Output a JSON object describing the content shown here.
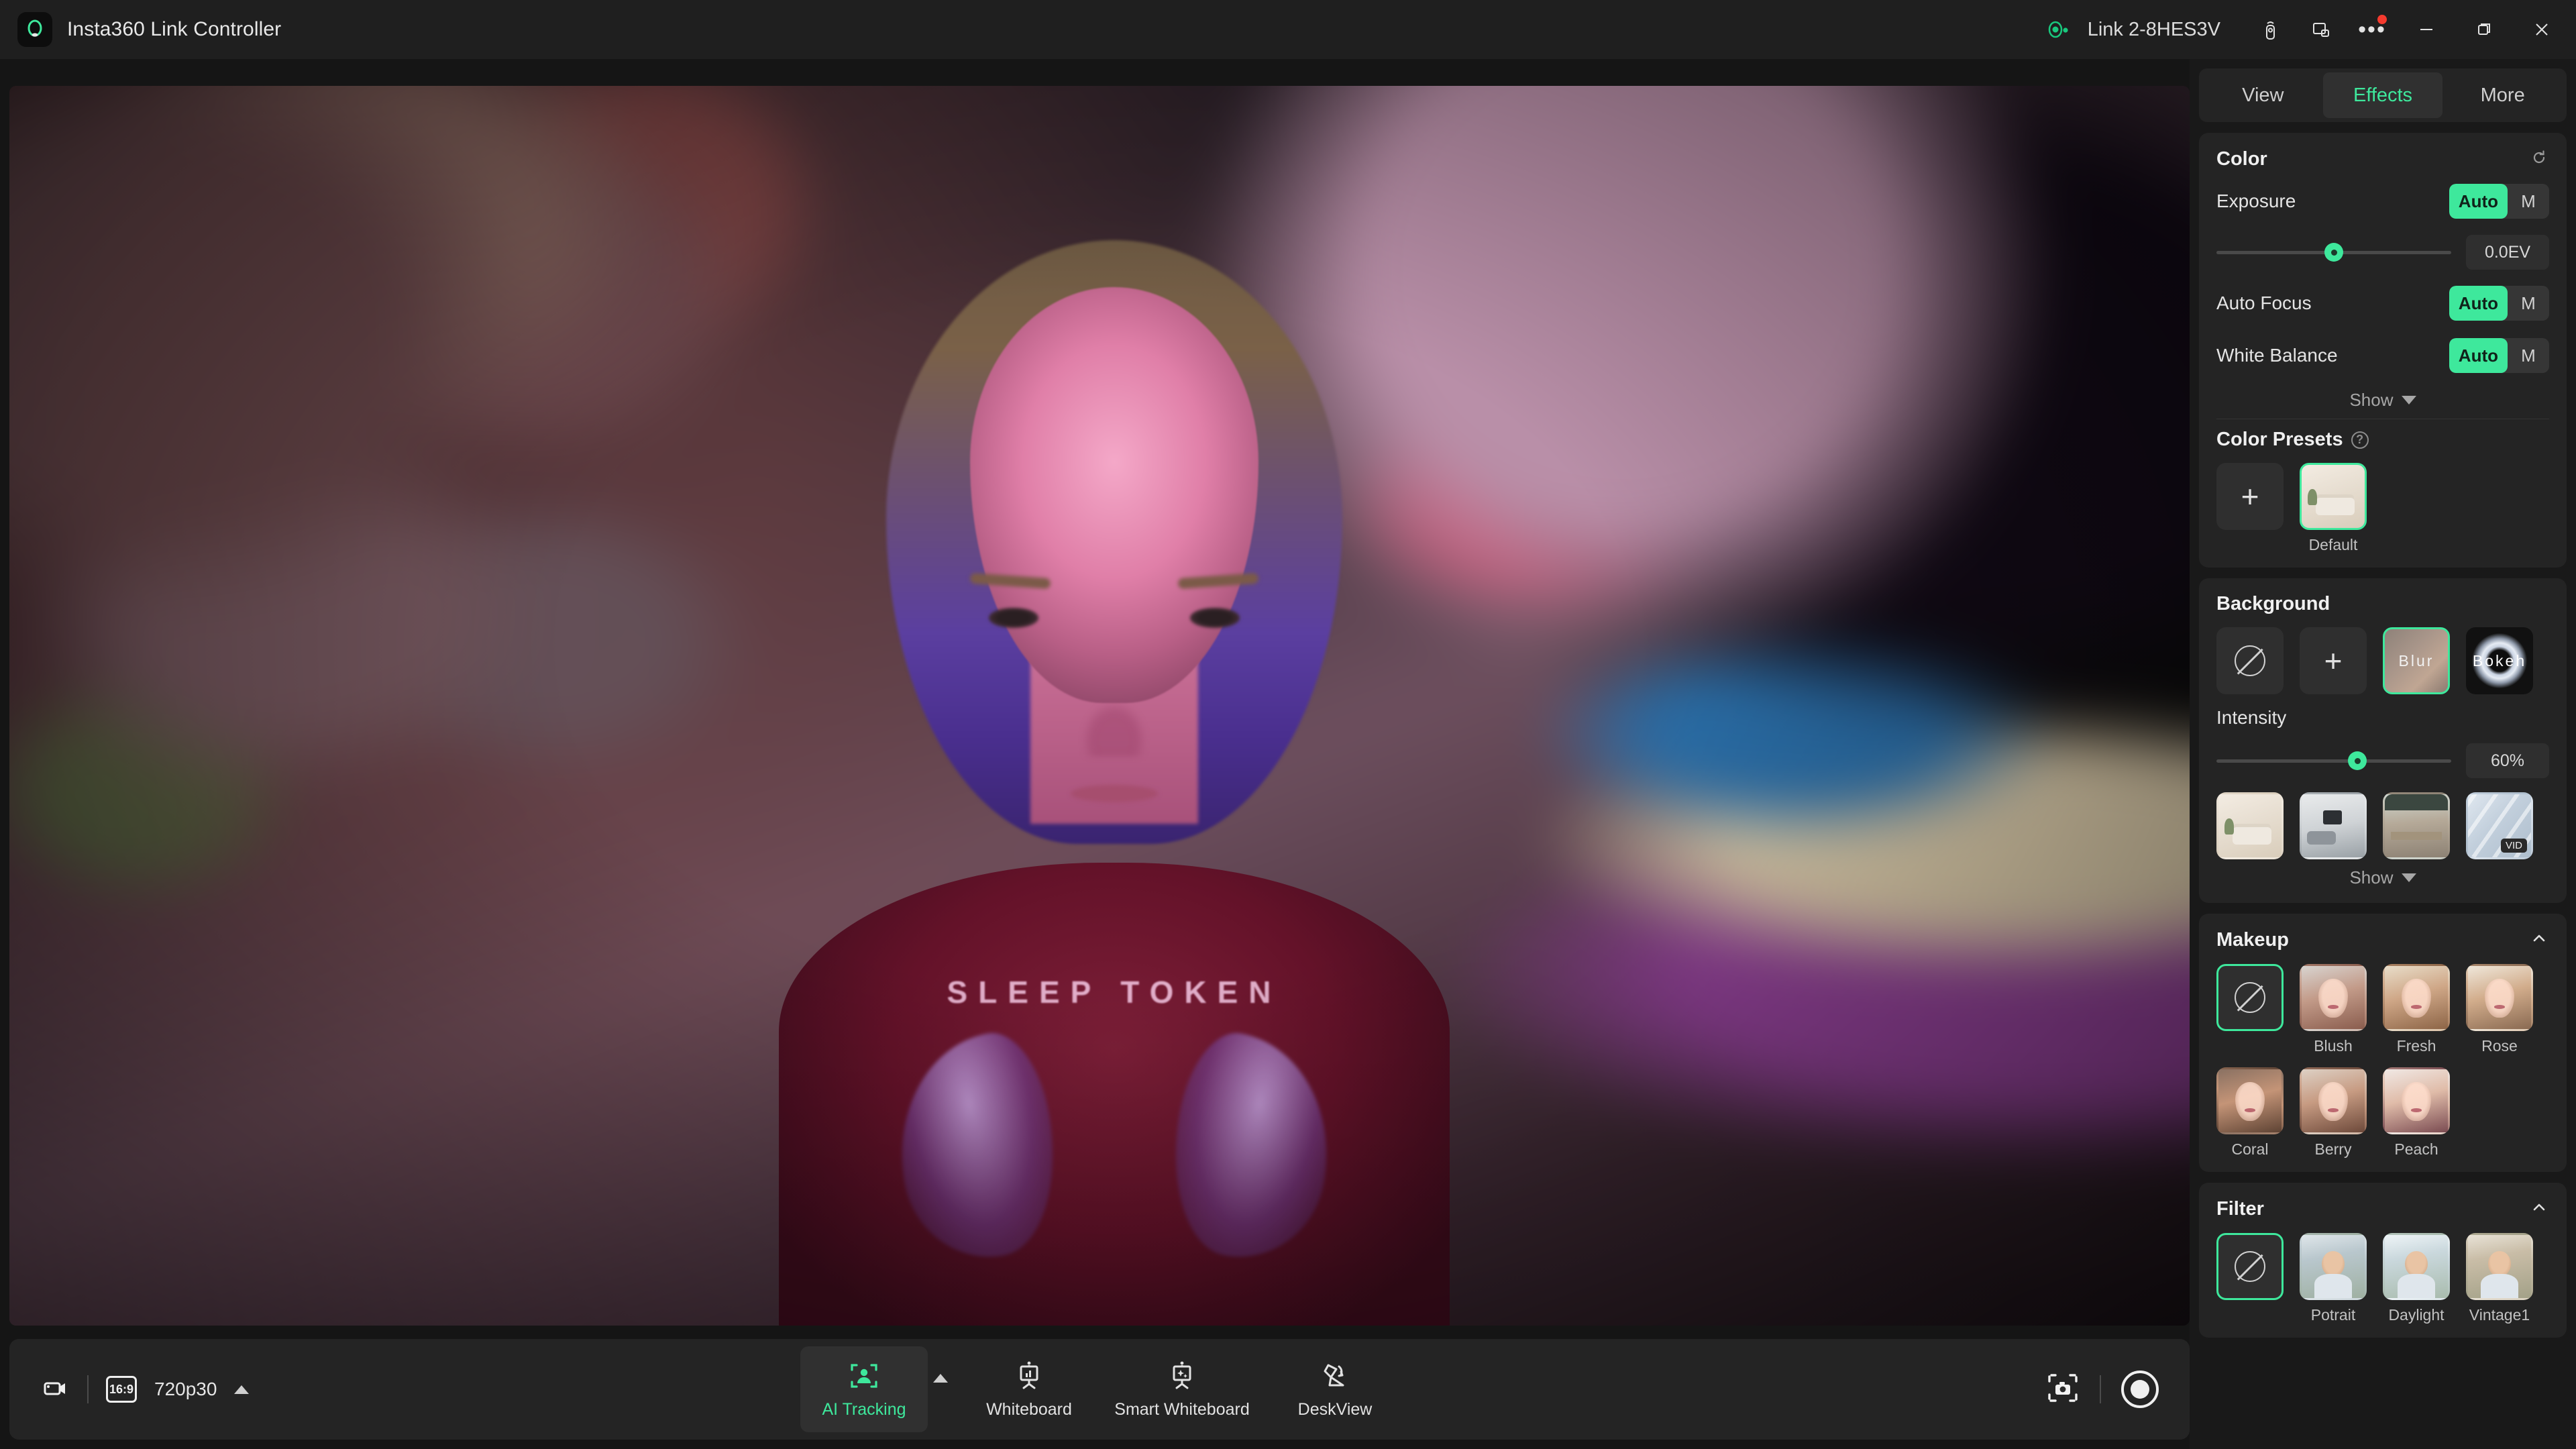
{
  "titlebar": {
    "app_name": "Insta360 Link Controller",
    "logo_icon": "insta360-logo-icon",
    "device_name": "Link 2-8HES3V",
    "camera_status_icon": "camera-connected-icon",
    "remote_icon": "remote-control-icon",
    "pip_icon": "picture-in-picture-icon",
    "more_icon": "more-options-icon",
    "minimize_icon": "minimize-icon",
    "maximize_icon": "maximize-icon",
    "close_icon": "close-icon"
  },
  "panel": {
    "tabs": [
      {
        "label": "View",
        "active": false
      },
      {
        "label": "Effects",
        "active": true
      },
      {
        "label": "More",
        "active": false
      }
    ],
    "color": {
      "title": "Color",
      "reset_icon": "reset-icon",
      "exposure": {
        "label": "Exposure",
        "auto_label": "Auto",
        "manual_label": "M",
        "mode": "Auto",
        "value": "0.0EV",
        "slider_pct": 50
      },
      "auto_focus": {
        "label": "Auto Focus",
        "auto_label": "Auto",
        "manual_label": "M",
        "mode": "Auto"
      },
      "white_balance": {
        "label": "White Balance",
        "auto_label": "Auto",
        "manual_label": "M",
        "mode": "Auto"
      },
      "show_label": "Show",
      "presets_title": "Color Presets",
      "presets_help_icon": "help-icon",
      "presets": [
        {
          "name": "",
          "icon": "add-preset-icon",
          "selected": false
        },
        {
          "name": "Default",
          "icon": "living-room-thumb",
          "selected": true
        }
      ]
    },
    "background": {
      "title": "Background",
      "options": [
        {
          "label": "",
          "icon": "none-icon",
          "selected": false
        },
        {
          "label": "",
          "icon": "add-background-icon",
          "selected": false
        },
        {
          "label": "Blur",
          "icon": "blur-thumb",
          "selected": true
        },
        {
          "label": "Bokeh",
          "icon": "bokeh-thumb",
          "selected": false
        }
      ],
      "intensity_label": "Intensity",
      "intensity_value": "60%",
      "intensity_pct": 60,
      "images": [
        {
          "label": "",
          "icon": "living-room-thumb",
          "badge": ""
        },
        {
          "label": "",
          "icon": "office-thumb",
          "badge": ""
        },
        {
          "label": "",
          "icon": "cafe-thumb",
          "badge": ""
        },
        {
          "label": "",
          "icon": "video-background-thumb",
          "badge": "VID"
        }
      ],
      "show_label": "Show"
    },
    "makeup": {
      "title": "Makeup",
      "collapse_icon": "chevron-up-icon",
      "row1": [
        {
          "label": "",
          "icon": "none-icon",
          "selected": true
        },
        {
          "label": "Blush",
          "icon": "makeup-blush-thumb",
          "selected": false
        },
        {
          "label": "Fresh",
          "icon": "makeup-fresh-thumb",
          "selected": false
        },
        {
          "label": "Rose",
          "icon": "makeup-rose-thumb",
          "selected": false
        }
      ],
      "row2": [
        {
          "label": "Coral",
          "icon": "makeup-coral-thumb",
          "selected": false
        },
        {
          "label": "Berry",
          "icon": "makeup-berry-thumb",
          "selected": false
        },
        {
          "label": "Peach",
          "icon": "makeup-peach-thumb",
          "selected": false
        }
      ]
    },
    "filter": {
      "title": "Filter",
      "collapse_icon": "chevron-up-icon",
      "items": [
        {
          "label": "",
          "icon": "none-icon",
          "selected": true
        },
        {
          "label": "Potrait",
          "icon": "filter-portrait-thumb",
          "selected": false
        },
        {
          "label": "Daylight",
          "icon": "filter-daylight-thumb",
          "selected": false
        },
        {
          "label": "Vintage1",
          "icon": "filter-vintage1-thumb",
          "selected": false
        }
      ]
    }
  },
  "bottombar": {
    "camera_icon": "camcorder-icon",
    "aspect_ratio": "16:9",
    "resolution": "720p30",
    "resolution_caret_icon": "chevron-up-icon",
    "modes": [
      {
        "label": "AI Tracking",
        "icon": "ai-tracking-icon",
        "active": true
      },
      {
        "label": "Whiteboard",
        "icon": "whiteboard-icon",
        "active": false
      },
      {
        "label": "Smart Whiteboard",
        "icon": "smart-whiteboard-icon",
        "active": false
      },
      {
        "label": "DeskView",
        "icon": "deskview-icon",
        "active": false
      }
    ],
    "mode_caret_icon": "chevron-up-icon",
    "snapshot_icon": "snapshot-icon",
    "record_icon": "record-button-icon"
  },
  "video": {
    "shirt_text": "SLEEP TOKEN"
  },
  "colors": {
    "accent": "#3EE89C",
    "panel_bg": "#191919",
    "card_bg": "#242424",
    "titlebar_bg": "#1f1f1f",
    "badge_red": "#f53a2e"
  }
}
